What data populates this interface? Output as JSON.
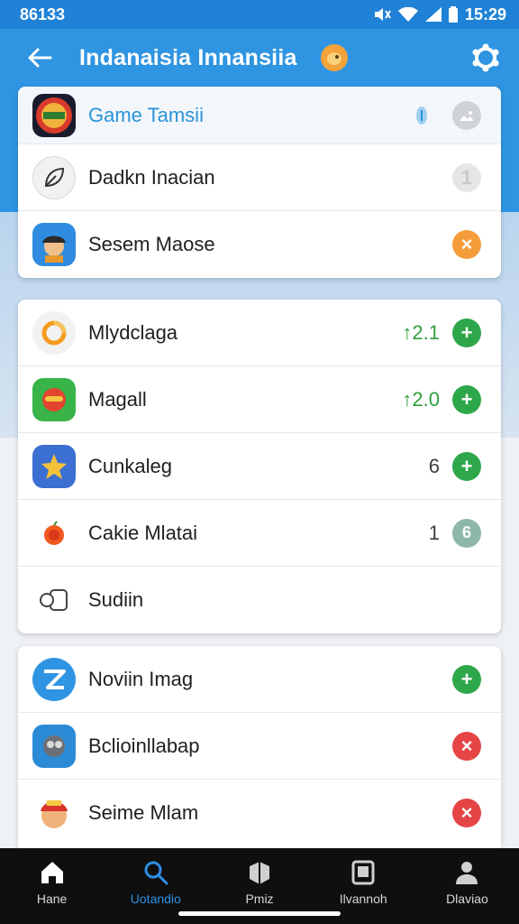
{
  "status_bar": {
    "time_left": "86133",
    "time_right": "15:29"
  },
  "app_bar": {
    "title": "Indanaisia Innansiia"
  },
  "cards": [
    {
      "rows": [
        {
          "label": "Game Tamsii",
          "icon": "game-badge-icon",
          "action": "image-icon",
          "style": "header"
        },
        {
          "label": "Dadkn Inacian",
          "icon": "leaf-icon",
          "action_text": "1",
          "action": "grey"
        },
        {
          "label": "Sesem Maose",
          "icon": "character-icon",
          "action_text": "×",
          "action": "orange"
        }
      ]
    },
    {
      "rows": [
        {
          "label": "Mlydclaga",
          "icon": "ring-icon",
          "value": "↑2.1",
          "action_text": "+",
          "action": "add"
        },
        {
          "label": "Magall",
          "icon": "mask-icon",
          "value": "↑2.0",
          "action_text": "+",
          "action": "add"
        },
        {
          "label": "Cunkaleg",
          "icon": "star-icon",
          "value": "6",
          "action_text": "+",
          "action": "add"
        },
        {
          "label": "Cakie Mlatai",
          "icon": "fruit-icon",
          "value": "1",
          "action_text": "6",
          "action": "teal"
        },
        {
          "label": "Sudiin",
          "icon": "controller-icon"
        }
      ]
    },
    {
      "rows": [
        {
          "label": "Noviin Imag",
          "icon": "z-logo-icon",
          "action_text": "+",
          "action": "add"
        },
        {
          "label": "Bclioinllabap",
          "icon": "robot-icon",
          "action_text": "×",
          "action": "remove"
        },
        {
          "label": "Seime Mlam",
          "icon": "hero-icon",
          "action_text": "×",
          "action": "remove"
        }
      ]
    }
  ],
  "nav": [
    {
      "label": "Hane",
      "icon": "home-icon"
    },
    {
      "label": "Uotandio",
      "icon": "search-icon",
      "active": true
    },
    {
      "label": "Pmiz",
      "icon": "box-icon"
    },
    {
      "label": "Ilvannoh",
      "icon": "tablet-icon"
    },
    {
      "label": "Dlaviao",
      "icon": "person-icon"
    }
  ],
  "colors": {
    "primary": "#2f95e2",
    "add": "#2ea74a",
    "remove": "#e54545",
    "orange": "#f59d3a",
    "value_green": "#2f9d3d"
  }
}
